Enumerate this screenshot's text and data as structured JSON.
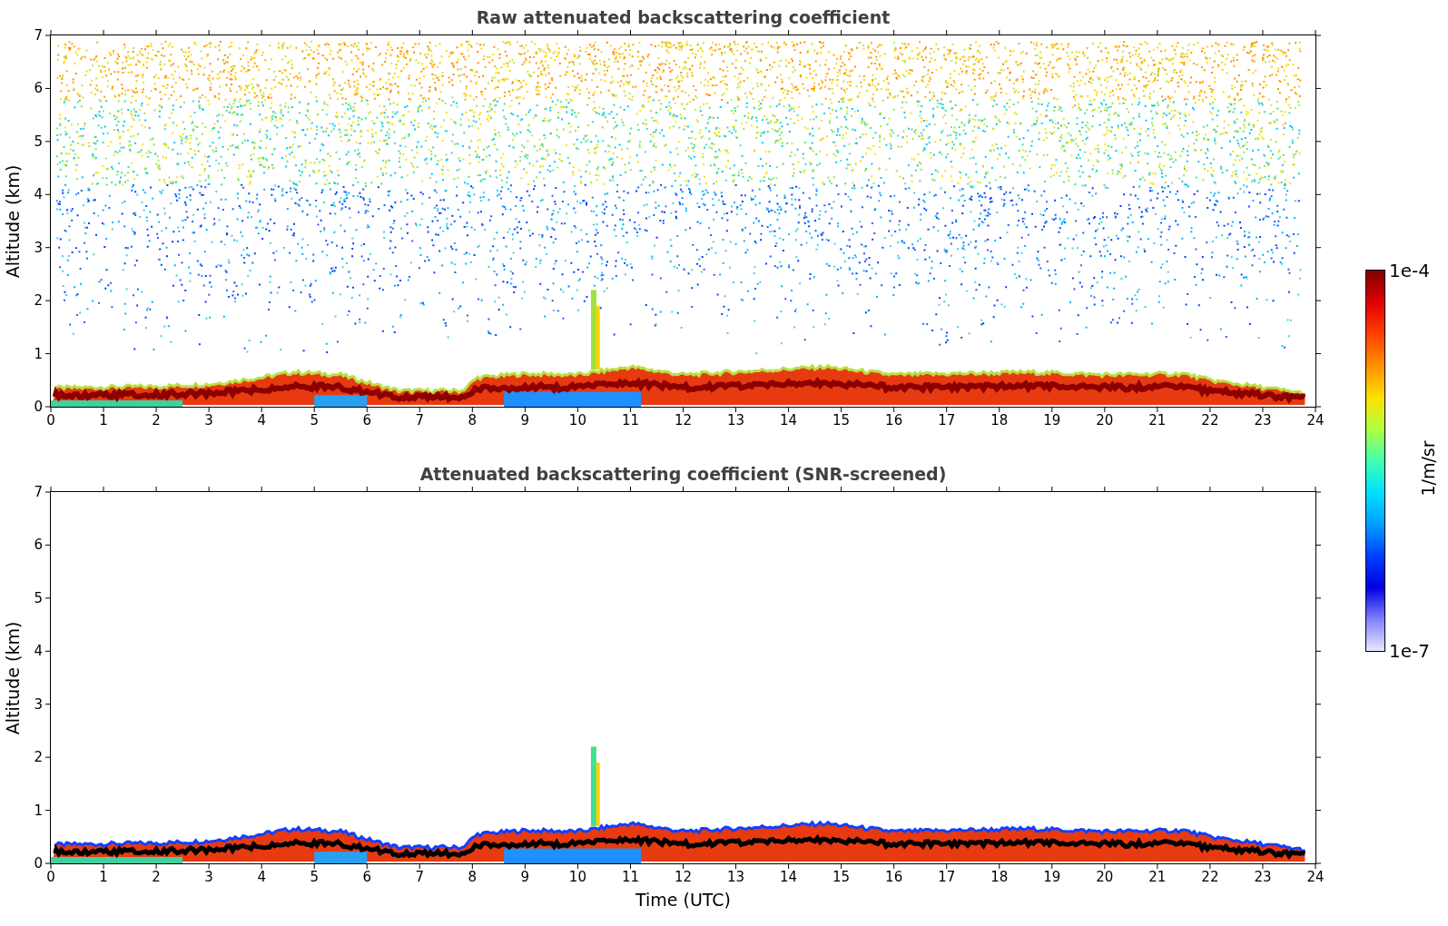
{
  "figure": {
    "panels": [
      {
        "kind": "raw",
        "title": "Raw attenuated backscattering coefficient",
        "ylabel": "Altitude (km)",
        "yticks": [
          "7",
          "6",
          "5",
          "4",
          "3",
          "2",
          "1",
          "0"
        ],
        "xticks": [
          "0",
          "1",
          "2",
          "3",
          "4",
          "5",
          "6",
          "7",
          "8",
          "9",
          "10",
          "11",
          "12",
          "13",
          "14",
          "15",
          "16",
          "17",
          "18",
          "19",
          "20",
          "21",
          "22",
          "23",
          "24"
        ]
      },
      {
        "kind": "screened",
        "title": "Attenuated backscattering coefficient (SNR-screened)",
        "ylabel": "Altitude (km)",
        "yticks": [
          "7",
          "6",
          "5",
          "4",
          "3",
          "2",
          "1",
          "0"
        ],
        "xticks": [
          "0",
          "1",
          "2",
          "3",
          "4",
          "5",
          "6",
          "7",
          "8",
          "9",
          "10",
          "11",
          "12",
          "13",
          "14",
          "15",
          "16",
          "17",
          "18",
          "19",
          "20",
          "21",
          "22",
          "23",
          "24"
        ],
        "xlabel": "Time (UTC)"
      }
    ],
    "colorbar": {
      "max_label": "1e-4",
      "min_label": "1e-7",
      "label": "1/m/sr"
    }
  }
}
